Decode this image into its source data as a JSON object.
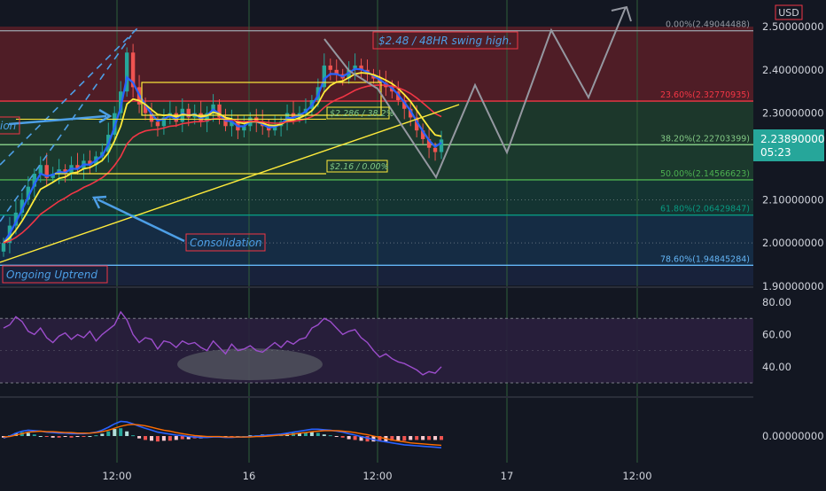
{
  "chart_data": [
    {
      "type": "line",
      "name": "price",
      "currency": "USD",
      "yaxis_ticks": [
        2.5,
        2.4,
        2.3,
        2.2,
        2.1,
        2.0,
        1.9
      ],
      "ylim": [
        1.9,
        2.51
      ],
      "x_tick_labels": [
        "12:00",
        "16",
        "12:00",
        "17",
        "12:00"
      ],
      "current_price": "2.23890000",
      "countdown": "05:23",
      "fib_levels": [
        {
          "label": "0.00%(2.49044488)",
          "value": 2.49044488,
          "color": "#9598a1"
        },
        {
          "label": "23.60%(2.32770935)",
          "value": 2.32770935,
          "color": "#f23645"
        },
        {
          "label": "38.20%(2.22703399)",
          "value": 2.22703399,
          "color": "#81c784"
        },
        {
          "label": "50.00%(2.14566623)",
          "value": 2.14566623,
          "color": "#4caf50"
        },
        {
          "label": "61.80%(2.06429847)",
          "value": 2.06429847,
          "color": "#089981"
        },
        {
          "label": "78.60%(1.94845284)",
          "value": 1.94845284,
          "color": "#64b5f6"
        }
      ],
      "annotations": {
        "swing_high": "$2.48 / 48HR swing high.",
        "level_2286": "$2.286 / 38.2%",
        "level_216": "$2.16 / 0.00%",
        "consolidation": "Consolidation",
        "ongoing_uptrend": "Ongoing Uptrend",
        "left_callout": "ion"
      },
      "close_series": [
        2.0,
        2.04,
        2.07,
        2.1,
        2.13,
        2.16,
        2.18,
        2.15,
        2.16,
        2.17,
        2.16,
        2.18,
        2.17,
        2.19,
        2.18,
        2.2,
        2.21,
        2.25,
        2.3,
        2.35,
        2.44,
        2.36,
        2.32,
        2.3,
        2.28,
        2.27,
        2.29,
        2.3,
        2.28,
        2.31,
        2.29,
        2.3,
        2.28,
        2.3,
        2.32,
        2.29,
        2.27,
        2.28,
        2.26,
        2.27,
        2.29,
        2.28,
        2.27,
        2.26,
        2.27,
        2.28,
        2.3,
        2.29,
        2.3,
        2.31,
        2.33,
        2.36,
        2.41,
        2.4,
        2.39,
        2.38,
        2.4,
        2.41,
        2.4,
        2.39,
        2.38,
        2.37,
        2.36,
        2.35,
        2.33,
        2.31,
        2.29,
        2.26,
        2.24,
        2.22,
        2.21,
        2.239
      ]
    },
    {
      "type": "line",
      "name": "rsi",
      "yaxis_ticks": [
        80,
        60,
        40
      ],
      "ylim": [
        30,
        85
      ],
      "bands": [
        70,
        30
      ],
      "values": [
        64,
        66,
        71,
        68,
        62,
        60,
        64,
        58,
        55,
        59,
        61,
        57,
        60,
        58,
        62,
        56,
        60,
        63,
        66,
        74,
        69,
        60,
        55,
        58,
        57,
        51,
        56,
        55,
        52,
        56,
        54,
        55,
        52,
        50,
        56,
        52,
        48,
        54,
        50,
        51,
        53,
        50,
        49,
        52,
        55,
        52,
        56,
        54,
        57,
        58,
        64,
        66,
        70,
        68,
        64,
        60,
        62,
        63,
        58,
        55,
        50,
        46,
        48,
        45,
        43,
        42,
        40,
        38,
        35,
        37,
        36,
        40
      ]
    },
    {
      "type": "bar",
      "name": "macd",
      "yaxis_ticks": [
        0.0
      ],
      "ytick_labels": [
        "0.00000000"
      ],
      "macd_line": [
        -0.004,
        0.0,
        0.006,
        0.01,
        0.012,
        0.011,
        0.01,
        0.008,
        0.007,
        0.006,
        0.006,
        0.005,
        0.005,
        0.005,
        0.006,
        0.008,
        0.012,
        0.018,
        0.025,
        0.03,
        0.029,
        0.025,
        0.02,
        0.016,
        0.012,
        0.008,
        0.006,
        0.004,
        0.002,
        0.001,
        -0.001,
        -0.002,
        -0.003,
        -0.003,
        -0.002,
        -0.002,
        -0.003,
        -0.003,
        -0.002,
        -0.002,
        -0.001,
        0.0,
        0.001,
        0.002,
        0.003,
        0.004,
        0.006,
        0.008,
        0.01,
        0.012,
        0.014,
        0.014,
        0.013,
        0.012,
        0.01,
        0.008,
        0.005,
        0.002,
        -0.001,
        -0.004,
        -0.007,
        -0.01,
        -0.012,
        -0.014,
        -0.016,
        -0.018,
        -0.019,
        -0.02,
        -0.021,
        -0.022,
        -0.023,
        -0.024
      ],
      "signal_line": [
        -0.002,
        -0.001,
        0.002,
        0.005,
        0.008,
        0.009,
        0.01,
        0.009,
        0.009,
        0.008,
        0.007,
        0.007,
        0.006,
        0.006,
        0.006,
        0.007,
        0.009,
        0.012,
        0.016,
        0.02,
        0.023,
        0.024,
        0.023,
        0.021,
        0.018,
        0.015,
        0.012,
        0.01,
        0.007,
        0.005,
        0.003,
        0.001,
        0.0,
        -0.001,
        -0.001,
        -0.001,
        -0.002,
        -0.002,
        -0.002,
        -0.002,
        -0.002,
        -0.001,
        -0.001,
        0.0,
        0.001,
        0.002,
        0.003,
        0.004,
        0.006,
        0.007,
        0.009,
        0.01,
        0.011,
        0.011,
        0.011,
        0.01,
        0.009,
        0.007,
        0.005,
        0.003,
        0.0,
        -0.003,
        -0.005,
        -0.008,
        -0.01,
        -0.012,
        -0.014,
        -0.015,
        -0.016,
        -0.017,
        -0.018,
        -0.019
      ]
    }
  ],
  "colors": {
    "background": "#131722",
    "up": "#26a69a",
    "down": "#ef5350",
    "ema_fast": "#2962ff",
    "ema_mid": "#ffeb3b",
    "ema_slow": "#f23645",
    "rsi": "#9c4dcc",
    "projection": "#9598a1",
    "annotation": "#4d9fe6"
  }
}
